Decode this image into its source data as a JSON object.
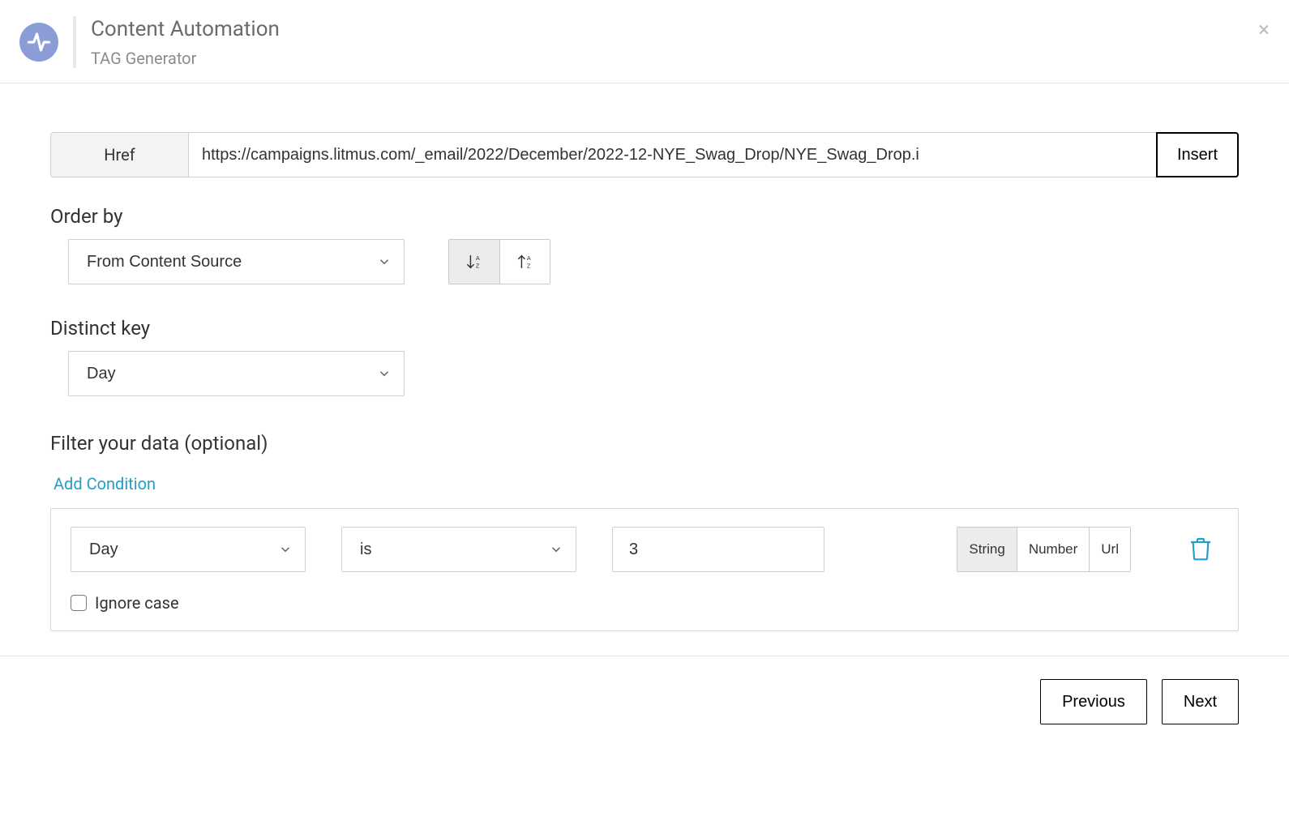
{
  "header": {
    "title": "Content Automation",
    "subtitle": "TAG Generator"
  },
  "href": {
    "label": "Href",
    "value": "https://campaigns.litmus.com/_email/2022/December/2022-12-NYE_Swag_Drop/NYE_Swag_Drop.i",
    "insert": "Insert"
  },
  "orderBy": {
    "label": "Order by",
    "value": "From Content Source",
    "sortDirection": "desc"
  },
  "distinct": {
    "label": "Distinct key",
    "value": "Day"
  },
  "filter": {
    "label": "Filter your data (optional)",
    "addCondition": "Add Condition",
    "condition": {
      "field": "Day",
      "operator": "is",
      "value": "3",
      "types": {
        "string": "String",
        "number": "Number",
        "url": "Url"
      },
      "activeType": "string"
    },
    "ignoreCase": "Ignore case"
  },
  "footer": {
    "previous": "Previous",
    "next": "Next"
  }
}
